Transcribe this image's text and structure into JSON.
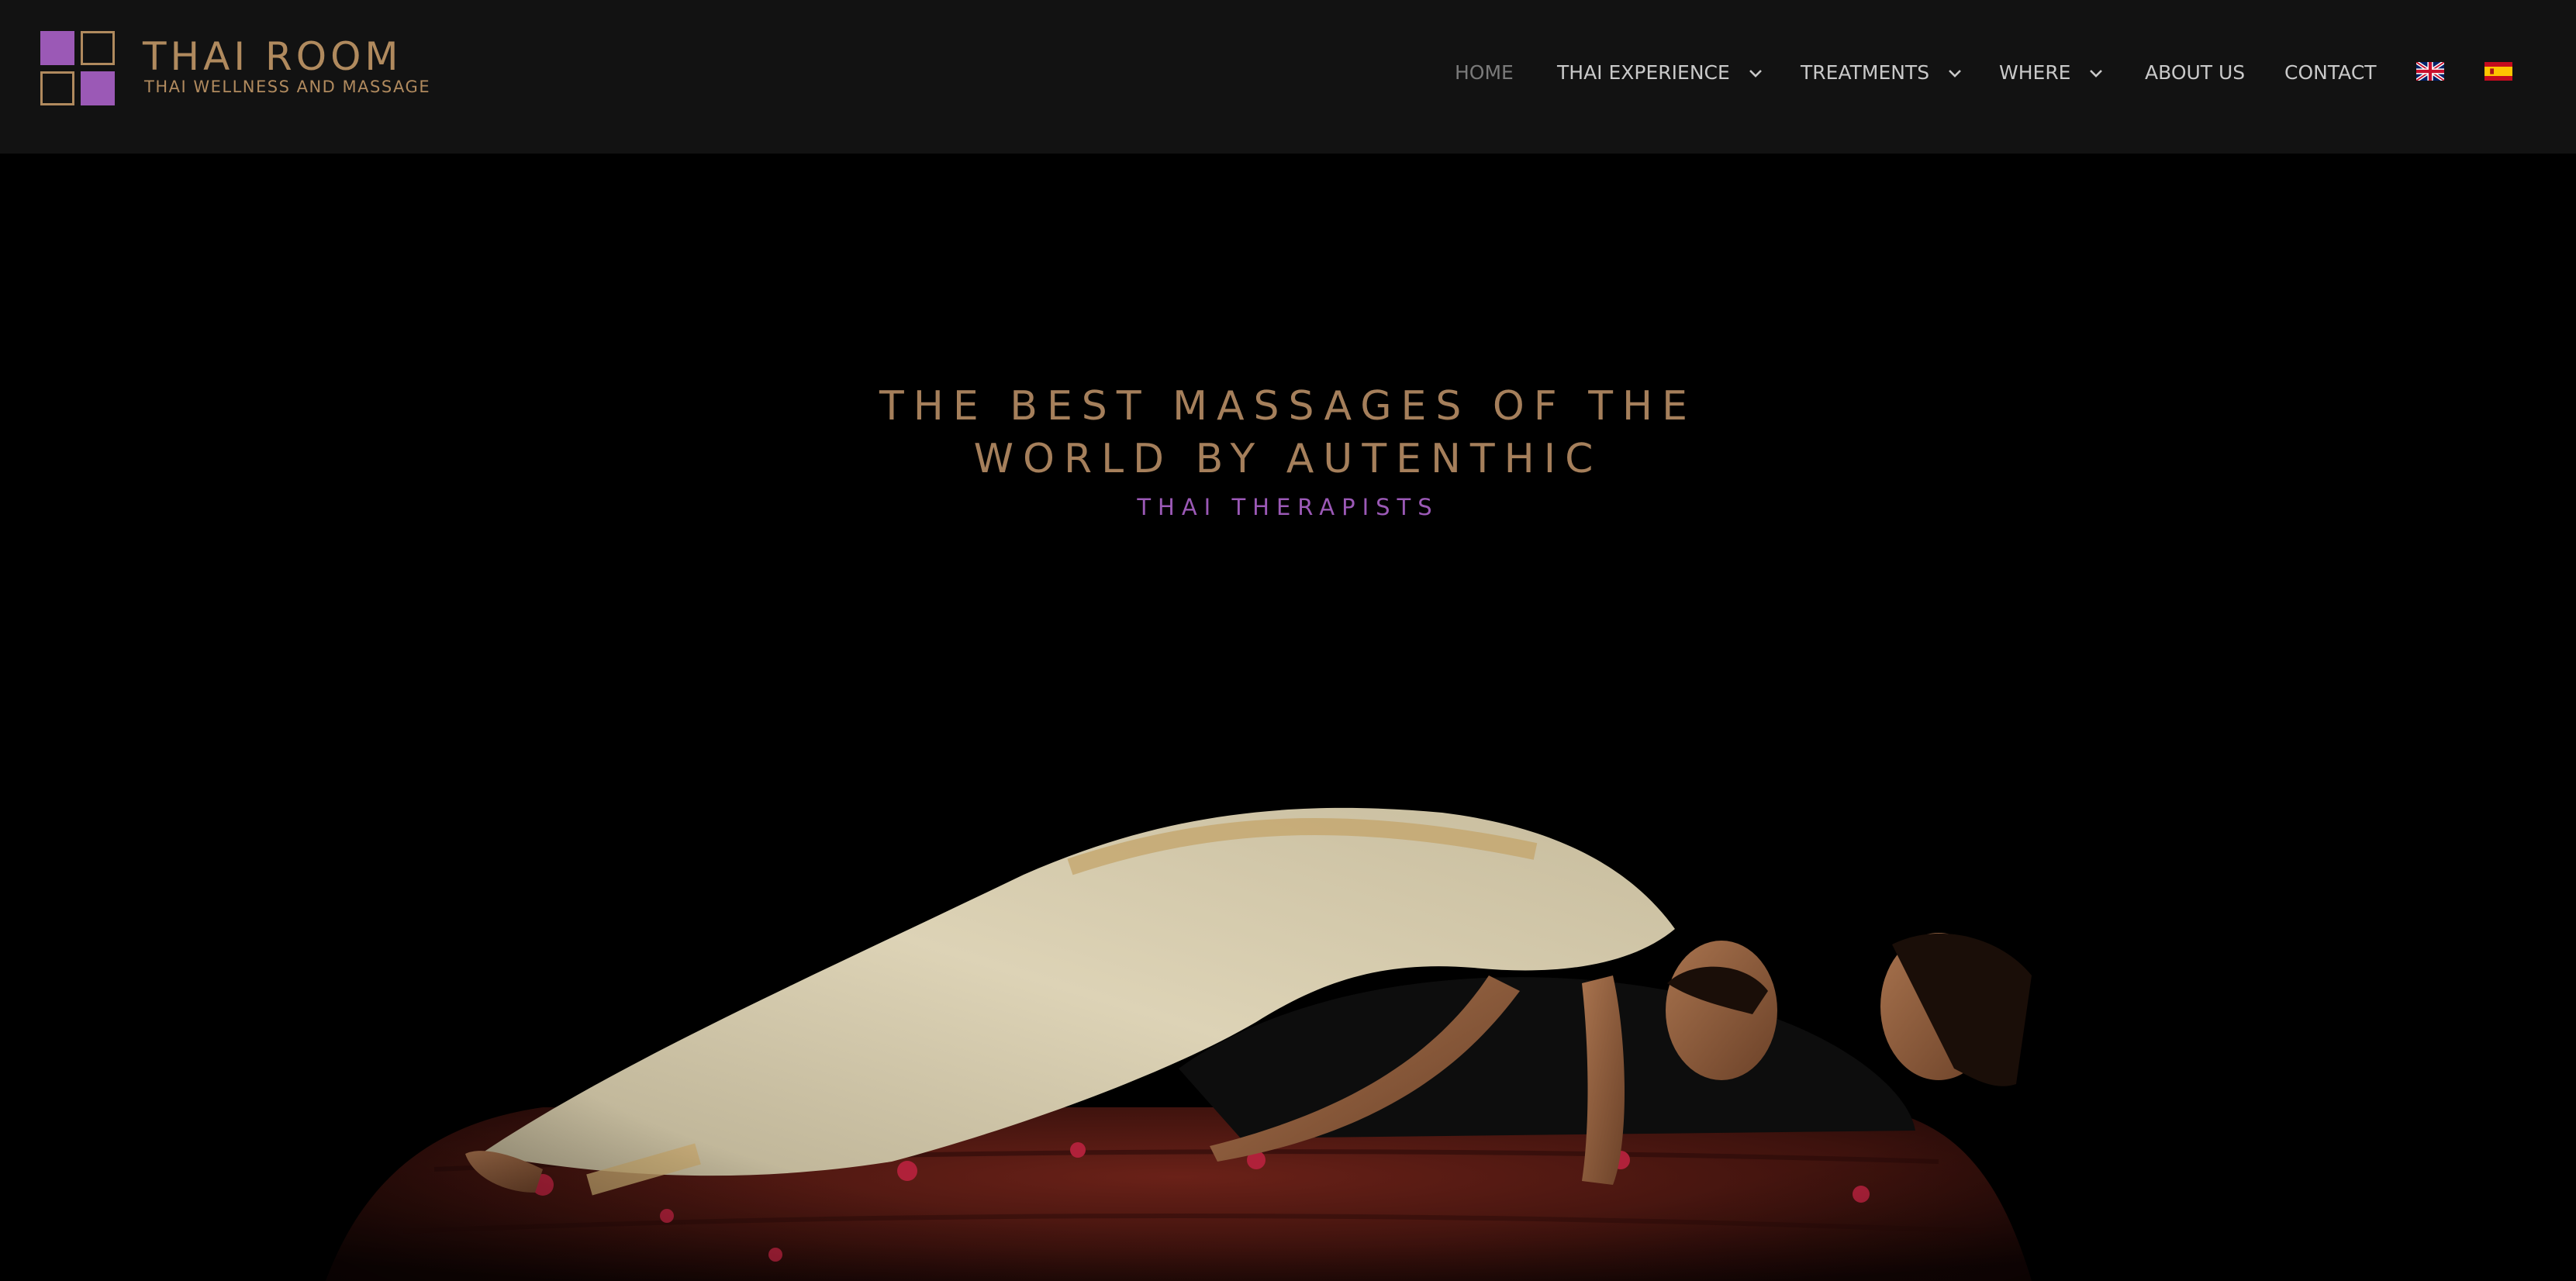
{
  "brand": {
    "name": "THAI ROOM",
    "tagline": "THAI WELLNESS AND MASSAGE",
    "accent_purple": "#9b59b6",
    "accent_gold": "#b08a5e"
  },
  "nav": {
    "items": [
      {
        "label": "HOME",
        "active": true,
        "has_dropdown": false
      },
      {
        "label": "THAI EXPERIENCE",
        "active": false,
        "has_dropdown": true
      },
      {
        "label": "TREATMENTS",
        "active": false,
        "has_dropdown": true
      },
      {
        "label": "WHERE",
        "active": false,
        "has_dropdown": true
      },
      {
        "label": "ABOUT US",
        "active": false,
        "has_dropdown": false
      },
      {
        "label": "CONTACT",
        "active": false,
        "has_dropdown": false
      }
    ],
    "languages": [
      {
        "code": "en",
        "icon": "uk-flag-icon"
      },
      {
        "code": "es",
        "icon": "spain-flag-icon"
      }
    ]
  },
  "hero": {
    "title_line1": "THE BEST MASSAGES OF THE",
    "title_line2": "WORLD BY AUTENTHIC",
    "subtitle": "THAI THERAPISTS",
    "image": "thai-massage-photo"
  }
}
